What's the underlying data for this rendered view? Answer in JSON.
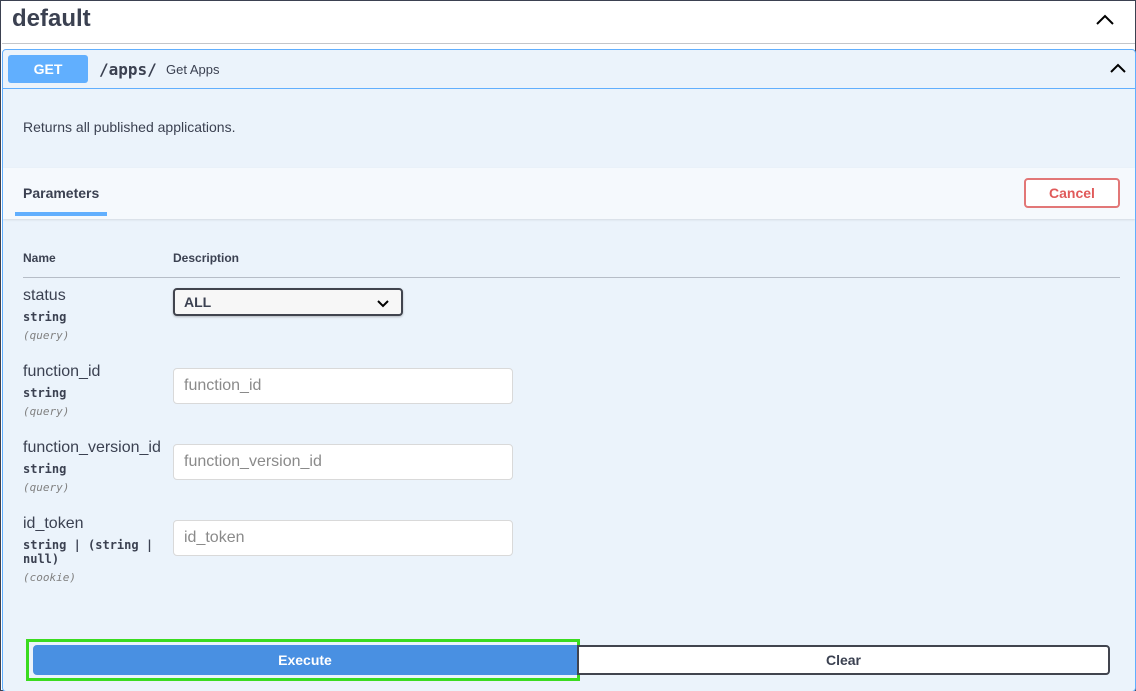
{
  "section": {
    "title": "default",
    "chevron_icon": "chevron-up-icon"
  },
  "operation": {
    "method": "GET",
    "path": "/apps/",
    "summary": "Get Apps",
    "description": "Returns all published applications.",
    "chevron_icon": "chevron-up-icon",
    "method_color": "#61affe"
  },
  "parameters": {
    "tab_label": "Parameters",
    "cancel_label": "Cancel",
    "columns": {
      "name": "Name",
      "description": "Description"
    },
    "items": [
      {
        "name": "status",
        "type": "string",
        "in": "(query)",
        "selected": "ALL"
      },
      {
        "name": "function_id",
        "type": "string",
        "in": "(query)",
        "placeholder": "function_id"
      },
      {
        "name": "function_version_id",
        "type": "string",
        "in": "(query)",
        "placeholder": "function_version_id"
      },
      {
        "name": "id_token",
        "type_line1": "string | (string |",
        "type_line2": "null)",
        "in": "(cookie)",
        "placeholder": "id_token"
      }
    ]
  },
  "actions": {
    "execute_label": "Execute",
    "clear_label": "Clear"
  },
  "colors": {
    "accent": "#61affe",
    "execute": "#4990e2",
    "cancel": "#e27777",
    "highlight": "#3adb1f"
  }
}
